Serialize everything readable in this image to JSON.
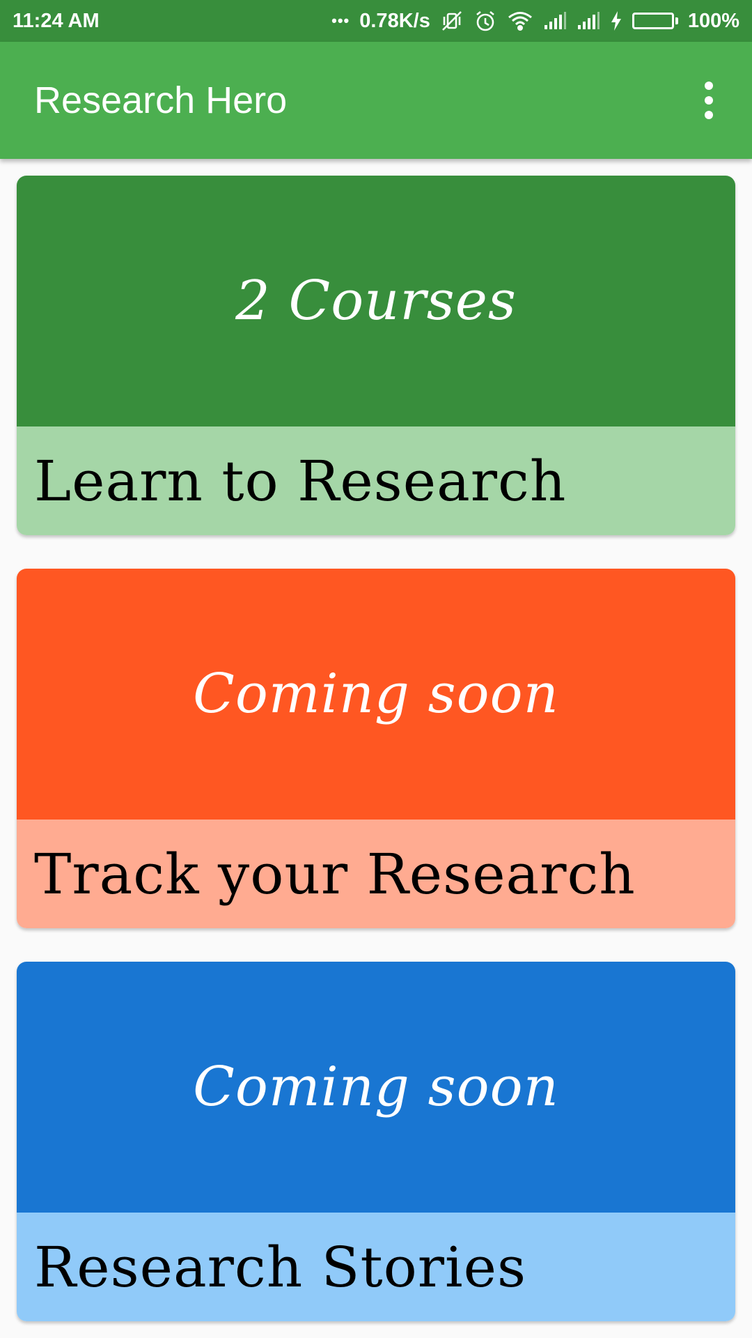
{
  "status_bar": {
    "time": "11:24 AM",
    "dots": "•••",
    "network_speed": "0.78K/s",
    "battery_percent": "100%",
    "battery_level": 1.0,
    "icons": [
      "vibrate-off-icon",
      "alarm-icon",
      "wifi-icon",
      "signal-icon",
      "signal-icon",
      "charging-icon",
      "battery-icon"
    ]
  },
  "app_bar": {
    "title": "Research Hero",
    "menu_icon": "more-vert-icon"
  },
  "cards": [
    {
      "banner": "2 Courses",
      "title": "Learn to Research",
      "top_color": "#388e3c",
      "bottom_color": "#a5d6a7"
    },
    {
      "banner": "Coming soon",
      "title": "Track your Research",
      "top_color": "#ff5722",
      "bottom_color": "#ffab91"
    },
    {
      "banner": "Coming soon",
      "title": "Research Stories",
      "top_color": "#1976d2",
      "bottom_color": "#90caf9"
    }
  ],
  "colors": {
    "status_bar": "#388e3c",
    "app_bar": "#4caf50",
    "background": "#fafafa"
  }
}
